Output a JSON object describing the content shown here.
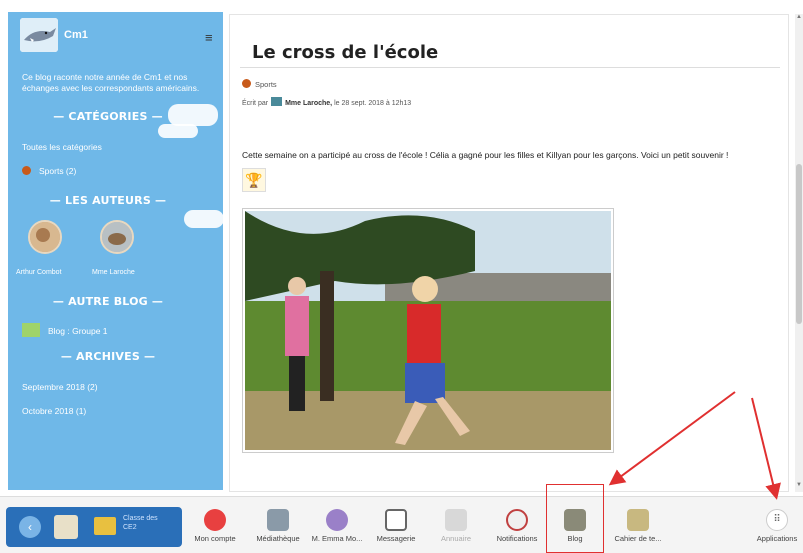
{
  "sidebar": {
    "blog_title": "Cm1",
    "description": "Ce blog raconte notre année de Cm1 et nos échanges avec les correspondants américains.",
    "categories_heading": "— CATÉGORIES —",
    "all_categories": "Toutes les catégories",
    "category_sports": "Sports (2)",
    "authors_heading": "— LES AUTEURS —",
    "authors": [
      {
        "name": "Arthur Combot"
      },
      {
        "name": "Mme Laroche"
      }
    ],
    "other_blog_heading": "— AUTRE BLOG —",
    "other_blog": "Blog : Groupe 1",
    "archives_heading": "— ARCHIVES —",
    "archives": [
      "Septembre 2018 (2)",
      "Octobre 2018 (1)"
    ]
  },
  "article": {
    "title": "Le cross de l'école",
    "category": "Sports",
    "written_by_prefix": "Écrit par",
    "author": "Mme Laroche,",
    "date": "le 28 sept. 2018 à 12h13",
    "body": "Cette semaine on a participé au cross de l'école ! Célia a gagné pour les filles et Killyan pour les garçons. Voici un petit souvenir !"
  },
  "bottombar": {
    "classe_label": "Classe des CE2",
    "items": [
      {
        "label": "Mon compte",
        "icon": "account-icon"
      },
      {
        "label": "Médiathèque",
        "icon": "media-icon"
      },
      {
        "label": "M. Emma Mo...",
        "icon": "user-icon"
      },
      {
        "label": "Messagerie",
        "icon": "mail-icon"
      },
      {
        "label": "Annuaire",
        "icon": "directory-icon"
      },
      {
        "label": "Notifications",
        "icon": "bell-icon"
      },
      {
        "label": "Blog",
        "icon": "blog-icon"
      },
      {
        "label": "Cahier de te...",
        "icon": "notebook-icon"
      },
      {
        "label": "Applications",
        "icon": "apps-grid-icon"
      }
    ]
  },
  "colors": {
    "sidebar": "#6fb8e8",
    "classe_block": "#2a6fb8",
    "highlight": "#e03030"
  }
}
